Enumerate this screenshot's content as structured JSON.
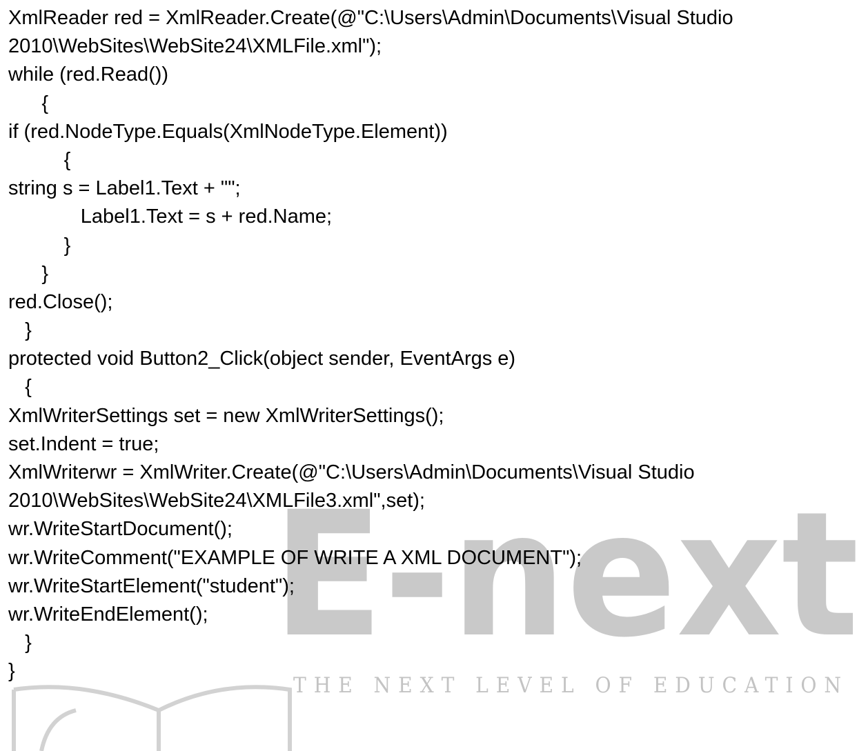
{
  "watermark": {
    "brand_word": "E-next",
    "tagline": "THE NEXT LEVEL OF EDUCATION",
    "color": "#c9c9c9"
  },
  "code_lines": [
    "XmlReader red = XmlReader.Create(@\"C:\\Users\\Admin\\Documents\\Visual Studio",
    "2010\\WebSites\\WebSite24\\XMLFile.xml\");",
    "while (red.Read())",
    "      {",
    "if (red.NodeType.Equals(XmlNodeType.Element))",
    "          {",
    "string s = Label1.Text + \"\";",
    "             Label1.Text = s + red.Name;",
    "          }",
    "      }",
    "red.Close();",
    "   }",
    "protected void Button2_Click(object sender, EventArgs e)",
    "   {",
    "XmlWriterSettings set = new XmlWriterSettings();",
    "set.Indent = true;",
    "XmlWriterwr = XmlWriter.Create(@\"C:\\Users\\Admin\\Documents\\Visual Studio",
    "2010\\WebSites\\WebSite24\\XMLFile3.xml\",set);",
    "wr.WriteStartDocument();",
    "wr.WriteComment(\"EXAMPLE OF WRITE A XML DOCUMENT\");",
    "wr.WriteStartElement(\"student\");",
    "wr.WriteEndElement();",
    "   }",
    "}"
  ]
}
